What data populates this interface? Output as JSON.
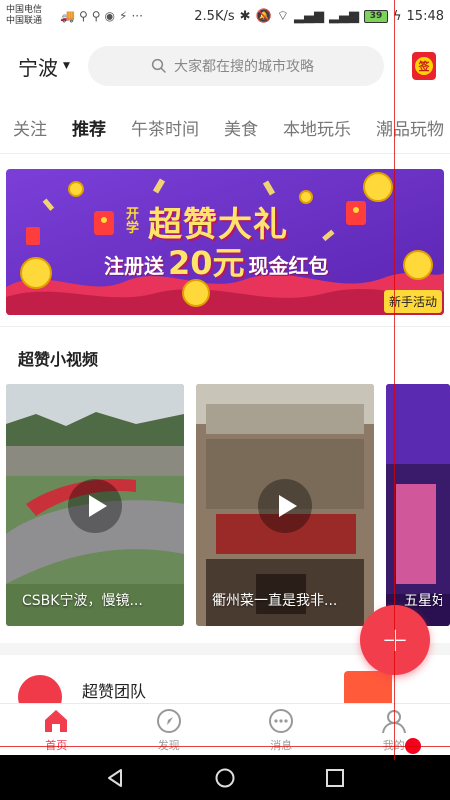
{
  "status_bar": {
    "carrier1": "中国电信",
    "carrier2": "中国联通",
    "speed": "2.5K/s",
    "battery": "39",
    "time": "15:48"
  },
  "header": {
    "city": "宁波",
    "search_placeholder": "大家都在搜的城市攻略",
    "sign_label": "签"
  },
  "tabs": [
    {
      "label": "关注"
    },
    {
      "label": "推荐"
    },
    {
      "label": "午茶时间"
    },
    {
      "label": "美食"
    },
    {
      "label": "本地玩乐"
    },
    {
      "label": "潮品玩物"
    }
  ],
  "banner": {
    "headline": "超赞大礼",
    "kaixue": "开学",
    "subline_prefix": "注册送",
    "amount": "20元",
    "subline_suffix": "现金红包",
    "tag": "新手活动"
  },
  "videos_section": {
    "title": "超赞小视频",
    "items": [
      {
        "caption": "CSBK宁波，慢镜..."
      },
      {
        "caption": "衢州菜一直是我非..."
      },
      {
        "caption": "五星好"
      }
    ]
  },
  "team": {
    "name": "超赞团队"
  },
  "fab": {
    "label": "+"
  },
  "bottom_nav": [
    {
      "label": "首页"
    },
    {
      "label": "发现"
    },
    {
      "label": "消息"
    },
    {
      "label": "我的"
    }
  ],
  "colors": {
    "accent": "#f23d4d",
    "banner_purple": "#6a2fc4",
    "banner_yellow": "#ffd83a"
  }
}
